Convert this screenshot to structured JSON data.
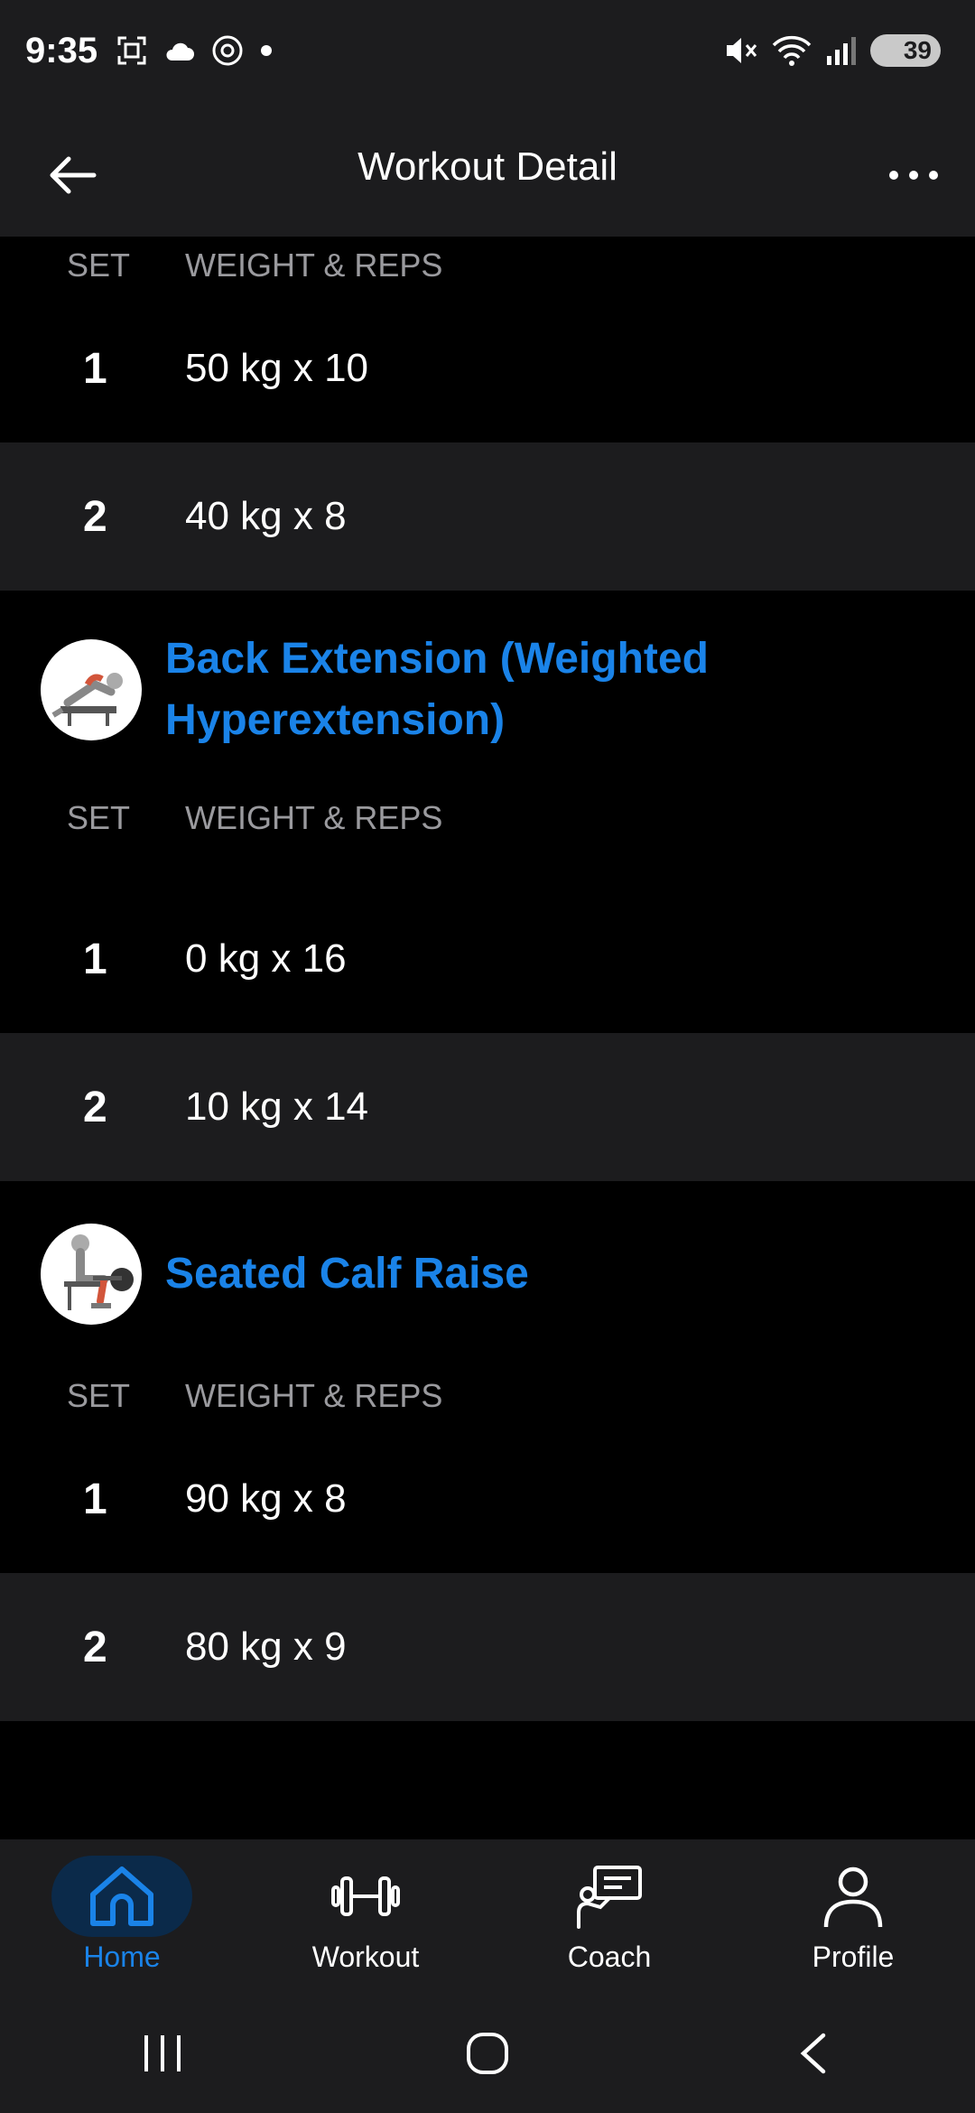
{
  "status": {
    "time": "9:35",
    "battery": "39"
  },
  "header": {
    "title": "Workout Detail"
  },
  "columns": {
    "set": "SET",
    "weight_reps": "WEIGHT & REPS"
  },
  "first_block": {
    "sets": [
      {
        "num": "1",
        "value": "50 kg x 10"
      },
      {
        "num": "2",
        "value": "40 kg x 8"
      }
    ]
  },
  "exercises": [
    {
      "name_line1": "Back Extension (Weighted",
      "name_line2": "Hyperextension)",
      "sets": [
        {
          "num": "1",
          "value": "0 kg x 16"
        },
        {
          "num": "2",
          "value": "10 kg x 14"
        }
      ]
    },
    {
      "name_line1": "Seated Calf Raise",
      "sets": [
        {
          "num": "1",
          "value": "90 kg x 8"
        },
        {
          "num": "2",
          "value": "80 kg x 9"
        }
      ]
    }
  ],
  "nav": {
    "items": [
      {
        "label": "Home",
        "icon": "home-icon",
        "active": true
      },
      {
        "label": "Workout",
        "icon": "dumbbell-icon"
      },
      {
        "label": "Coach",
        "icon": "coach-icon"
      },
      {
        "label": "Profile",
        "icon": "profile-icon"
      }
    ]
  },
  "colors": {
    "accent": "#1a83e8",
    "bar": "#1c1c1e",
    "background": "#000000"
  }
}
